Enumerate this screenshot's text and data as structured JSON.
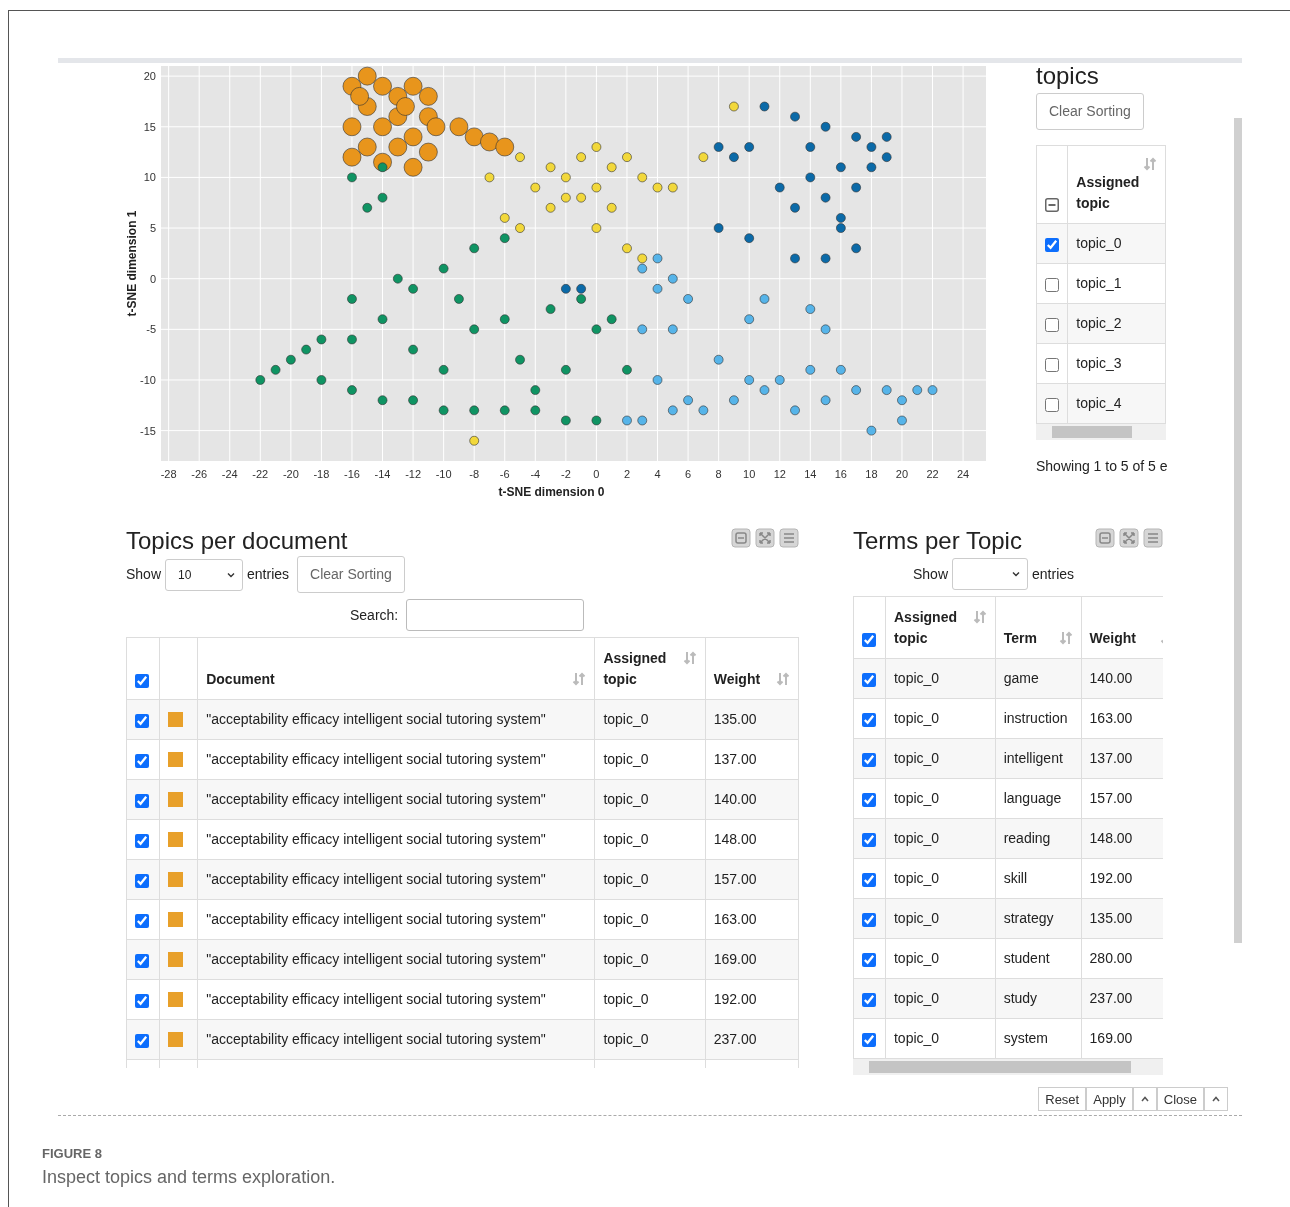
{
  "plot": {
    "chart_data": {
      "type": "scatter",
      "xlabel": "t-SNE dimension 0",
      "ylabel": "t-SNE dimension 1",
      "xlim": [
        -28.5,
        25.5
      ],
      "ylim": [
        -18,
        21
      ],
      "xticks": [
        -28,
        -26,
        -24,
        -22,
        -20,
        -18,
        -16,
        -14,
        -12,
        -10,
        -8,
        -6,
        -4,
        -2,
        0,
        2,
        4,
        6,
        8,
        10,
        12,
        14,
        16,
        18,
        20,
        22,
        24
      ],
      "yticks": [
        -15,
        -10,
        -5,
        0,
        5,
        10,
        15,
        20
      ],
      "grid": true,
      "series": [
        {
          "color": "#e8951c",
          "x": [
            -16,
            -15,
            -14,
            -13,
            -12,
            -11,
            -15,
            -13,
            -11,
            -16,
            -14,
            -12,
            -10.5,
            -15,
            -13,
            -11,
            -16,
            -14,
            -12,
            -9,
            -8,
            -7,
            -6,
            -15.5,
            -12.5
          ],
          "values": [
            19,
            20,
            19,
            18,
            19,
            18,
            17,
            16,
            16,
            15,
            15,
            14,
            15,
            13,
            13,
            12.5,
            12,
            11.5,
            11,
            15,
            14,
            13.5,
            13,
            18,
            17
          ]
        },
        {
          "color": "#f2d83b",
          "x": [
            -5,
            -3,
            -1,
            0,
            1,
            2,
            3,
            4,
            -2,
            -4,
            -1,
            0,
            1,
            -3,
            -5,
            0,
            2,
            3,
            5,
            -7,
            7,
            -8,
            9,
            -2,
            -6
          ],
          "values": [
            12,
            11,
            12,
            13,
            11,
            12,
            10,
            9,
            10,
            9,
            8,
            9,
            7,
            7,
            5,
            5,
            3,
            2,
            9,
            10,
            12,
            -16,
            17,
            8,
            6
          ]
        },
        {
          "color": "#0f9463",
          "x": [
            -22,
            -21,
            -20,
            -19,
            -18,
            -16,
            -14,
            -12,
            -10,
            -8,
            -6,
            -4,
            -2,
            0,
            -16,
            -14,
            -12,
            -10,
            -8,
            -6,
            -16,
            -13,
            -9,
            -6,
            -3,
            -1,
            -8,
            -5,
            -2,
            -12,
            -10,
            -16,
            -14,
            -15,
            -14,
            0,
            1,
            2,
            -4,
            -18
          ],
          "values": [
            -10,
            -9,
            -8,
            -7,
            -10,
            -11,
            -12,
            -12,
            -13,
            -13,
            -13,
            -13,
            -14,
            -14,
            -6,
            -4,
            -1,
            1,
            3,
            4,
            -2,
            0,
            -2,
            -4,
            -3,
            -2,
            -5,
            -8,
            -9,
            -7,
            -9,
            10,
            11,
            7,
            8,
            -5,
            -4,
            -9,
            -11,
            -6
          ]
        },
        {
          "color": "#0b6aa8",
          "x": [
            8,
            10,
            11,
            13,
            15,
            17,
            18,
            19,
            18,
            16,
            14,
            12,
            15,
            13,
            16,
            17,
            15,
            13,
            10,
            8,
            9,
            14,
            19,
            17,
            16,
            -1,
            -2
          ],
          "values": [
            13,
            13,
            17,
            16,
            15,
            14,
            13,
            14,
            11,
            11,
            10,
            9,
            8,
            7,
            5,
            3,
            2,
            2,
            4,
            5,
            12,
            13,
            12,
            9,
            6,
            -1,
            -1
          ]
        },
        {
          "color": "#56b4e9",
          "x": [
            3,
            4,
            5,
            4,
            6,
            5,
            3,
            4,
            5,
            3,
            7,
            9,
            11,
            13,
            15,
            17,
            19,
            21,
            22,
            18,
            20,
            14,
            12,
            10,
            8,
            15,
            14,
            11,
            16,
            20,
            6,
            2,
            10
          ],
          "values": [
            1,
            2,
            0,
            -1,
            -2,
            -5,
            -5,
            -10,
            -13,
            -14,
            -13,
            -12,
            -11,
            -13,
            -12,
            -11,
            -11,
            -11,
            -11,
            -15,
            -14,
            -9,
            -10,
            -10,
            -8,
            -5,
            -3,
            -2,
            -9,
            -12,
            -12,
            -14,
            -4
          ]
        }
      ]
    }
  },
  "topics_panel": {
    "title": "topics",
    "clear_button": "Clear Sorting",
    "header_checkbox": {
      "indeterminate": true
    },
    "columns": [
      "Assigned topic"
    ],
    "rows": [
      {
        "checked": true,
        "topic": "topic_0"
      },
      {
        "checked": false,
        "topic": "topic_1"
      },
      {
        "checked": false,
        "topic": "topic_2"
      },
      {
        "checked": false,
        "topic": "topic_3"
      },
      {
        "checked": false,
        "topic": "topic_4"
      }
    ],
    "info": "Showing 1 to 5 of 5 e"
  },
  "documents_panel": {
    "title": "Topics per document",
    "show_label": "Show",
    "page_length": "10",
    "entries_label": "entries",
    "clear_button": "Clear Sorting",
    "search_label": "Search:",
    "header_checkbox": {
      "checked": true
    },
    "columns": [
      "Document",
      "Assigned topic",
      "Weight"
    ],
    "rows": [
      {
        "checked": true,
        "color": "#e8a02a",
        "document": "\"acceptability efficacy intelligent social tutoring system\"",
        "topic": "topic_0",
        "weight": "135.00"
      },
      {
        "checked": true,
        "color": "#e8a02a",
        "document": "\"acceptability efficacy intelligent social tutoring system\"",
        "topic": "topic_0",
        "weight": "137.00"
      },
      {
        "checked": true,
        "color": "#e8a02a",
        "document": "\"acceptability efficacy intelligent social tutoring system\"",
        "topic": "topic_0",
        "weight": "140.00"
      },
      {
        "checked": true,
        "color": "#e8a02a",
        "document": "\"acceptability efficacy intelligent social tutoring system\"",
        "topic": "topic_0",
        "weight": "148.00"
      },
      {
        "checked": true,
        "color": "#e8a02a",
        "document": "\"acceptability efficacy intelligent social tutoring system\"",
        "topic": "topic_0",
        "weight": "157.00"
      },
      {
        "checked": true,
        "color": "#e8a02a",
        "document": "\"acceptability efficacy intelligent social tutoring system\"",
        "topic": "topic_0",
        "weight": "163.00"
      },
      {
        "checked": true,
        "color": "#e8a02a",
        "document": "\"acceptability efficacy intelligent social tutoring system\"",
        "topic": "topic_0",
        "weight": "169.00"
      },
      {
        "checked": true,
        "color": "#e8a02a",
        "document": "\"acceptability efficacy intelligent social tutoring system\"",
        "topic": "topic_0",
        "weight": "192.00"
      },
      {
        "checked": true,
        "color": "#e8a02a",
        "document": "\"acceptability efficacy intelligent social tutoring system\"",
        "topic": "topic_0",
        "weight": "237.00"
      }
    ]
  },
  "terms_panel": {
    "title": "Terms per Topic",
    "show_label": "Show",
    "entries_label": "entries",
    "header_checkbox": {
      "checked": true
    },
    "columns": [
      "Assigned topic",
      "Term",
      "Weight"
    ],
    "rows": [
      {
        "checked": true,
        "topic": "topic_0",
        "term": "game",
        "weight": "140.00"
      },
      {
        "checked": true,
        "topic": "topic_0",
        "term": "instruction",
        "weight": "163.00"
      },
      {
        "checked": true,
        "topic": "topic_0",
        "term": "intelligent",
        "weight": "137.00"
      },
      {
        "checked": true,
        "topic": "topic_0",
        "term": "language",
        "weight": "157.00"
      },
      {
        "checked": true,
        "topic": "topic_0",
        "term": "reading",
        "weight": "148.00"
      },
      {
        "checked": true,
        "topic": "topic_0",
        "term": "skill",
        "weight": "192.00"
      },
      {
        "checked": true,
        "topic": "topic_0",
        "term": "strategy",
        "weight": "135.00"
      },
      {
        "checked": true,
        "topic": "topic_0",
        "term": "student",
        "weight": "280.00"
      },
      {
        "checked": true,
        "topic": "topic_0",
        "term": "study",
        "weight": "237.00"
      },
      {
        "checked": true,
        "topic": "topic_0",
        "term": "system",
        "weight": "169.00"
      }
    ]
  },
  "footer_buttons": [
    {
      "kind": "button",
      "label": "Reset"
    },
    {
      "kind": "button",
      "label": "Apply"
    },
    {
      "kind": "caret"
    },
    {
      "kind": "button",
      "label": "Close"
    },
    {
      "kind": "caret"
    }
  ],
  "caption": {
    "label": "FIGURE 8",
    "text": "Inspect topics and terms exploration."
  }
}
